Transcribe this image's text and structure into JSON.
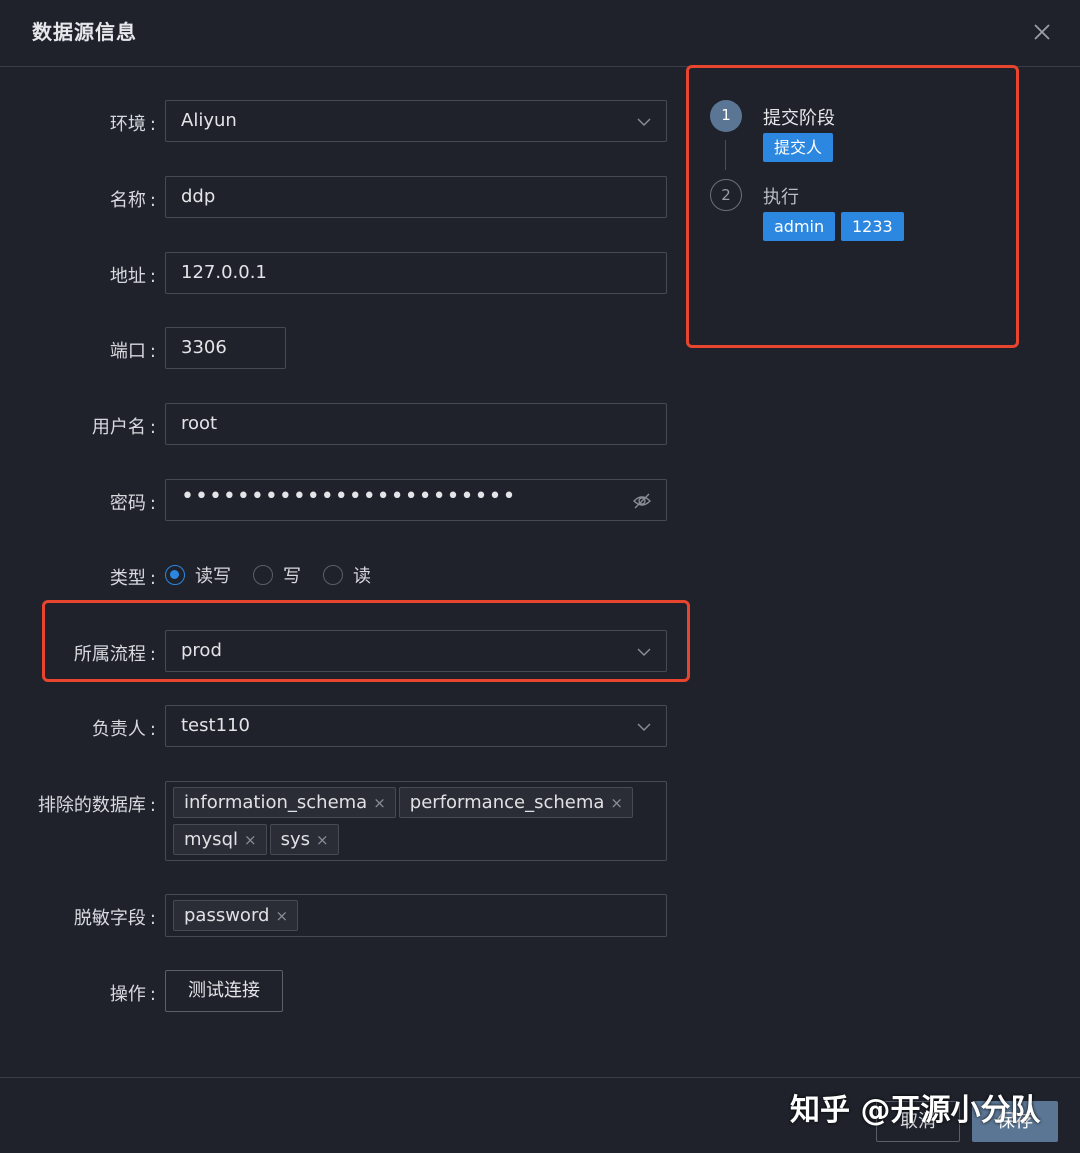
{
  "dialog": {
    "title": "数据源信息"
  },
  "colon": ":",
  "form": {
    "env": {
      "label": "环境",
      "value": "Aliyun"
    },
    "name": {
      "label": "名称",
      "value": "ddp"
    },
    "address": {
      "label": "地址",
      "value": "127.0.0.1"
    },
    "port": {
      "label": "端口",
      "value": "3306"
    },
    "username": {
      "label": "用户名",
      "value": "root"
    },
    "password": {
      "label": "密码",
      "value": "••••••••••••••••••••••••"
    },
    "type": {
      "label": "类型",
      "options": [
        "读写",
        "写",
        "读"
      ],
      "selected": "读写"
    },
    "flow": {
      "label": "所属流程",
      "value": "prod"
    },
    "owner": {
      "label": "负责人",
      "value": "test110"
    },
    "excluded_db": {
      "label": "排除的数据库",
      "tags": [
        "information_schema",
        "performance_schema",
        "mysql",
        "sys"
      ]
    },
    "masked_fields": {
      "label": "脱敏字段",
      "tags": [
        "password"
      ]
    },
    "action": {
      "label": "操作",
      "button": "测试连接"
    }
  },
  "steps": [
    {
      "num": "1",
      "title": "提交阶段",
      "status": "active",
      "badges": [
        "提交人"
      ]
    },
    {
      "num": "2",
      "title": "执行",
      "status": "wait",
      "badges": [
        "admin",
        "1233"
      ]
    }
  ],
  "footer": {
    "cancel": "取消",
    "ok": "保存"
  },
  "watermark": "知乎 @开源小分队",
  "tag_remove_glyph": "×",
  "colors": {
    "accent": "#2b87e0",
    "step_active": "#5b7694",
    "highlight": "#e8452f",
    "background": "#1f222b"
  },
  "icons": [
    "close-icon",
    "chevron-down-icon",
    "eye-off-icon",
    "remove-tag-icon"
  ]
}
